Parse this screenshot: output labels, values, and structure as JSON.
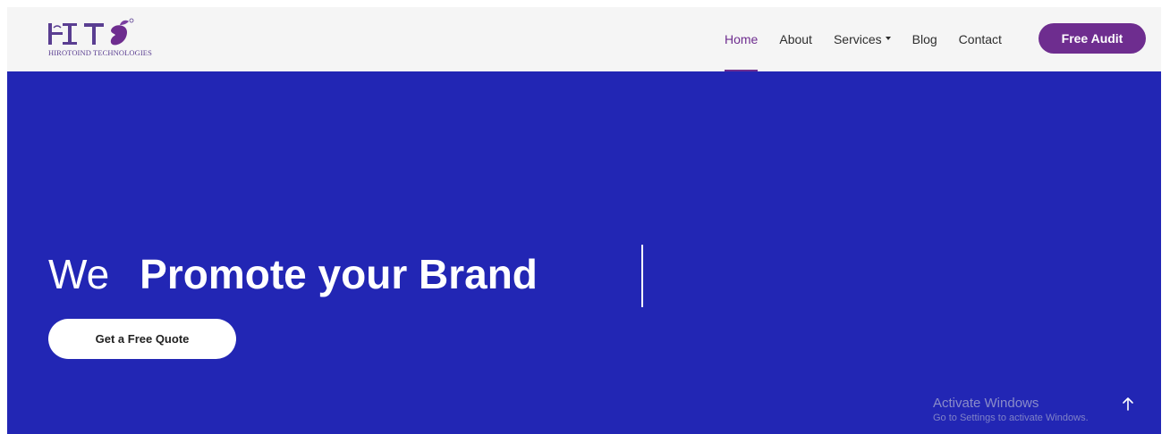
{
  "header": {
    "brand_subtitle": "HIROTOIND TECHNOLOGIES",
    "nav": {
      "home": "Home",
      "about": "About",
      "services": "Services",
      "blog": "Blog",
      "contact": "Contact"
    },
    "cta_label": "Free Audit"
  },
  "hero": {
    "title_prefix": "We",
    "title_main": "Promote your Brand",
    "cta_label": "Get a Free Quote"
  },
  "os_watermark": {
    "title": "Activate Windows",
    "subtitle": "Go to Settings to activate Windows."
  },
  "icons": {
    "logo": "hit-logo-mango-icon",
    "dropdown": "caret-down-icon",
    "scroll_top": "arrow-up-icon"
  },
  "colors": {
    "hero_background": "#2226b4",
    "accent": "#6e2d8f",
    "navbar_background": "#f5f5f5"
  }
}
